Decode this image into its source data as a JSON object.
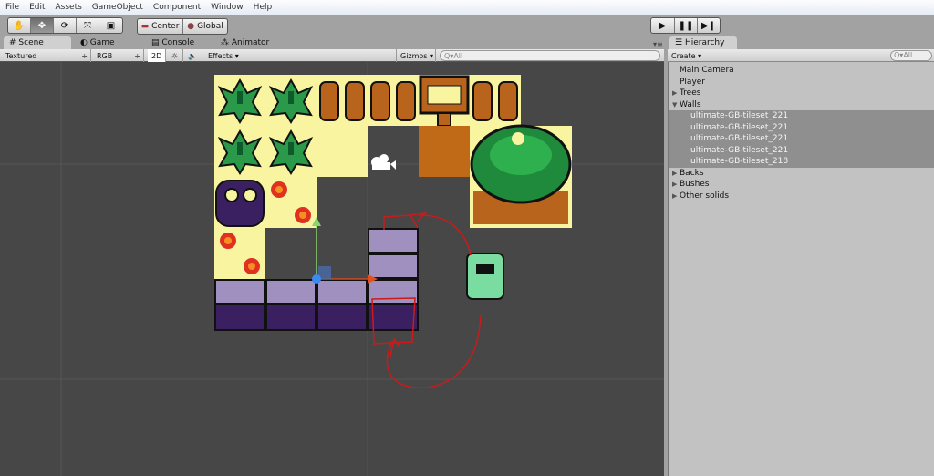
{
  "menu": [
    "File",
    "Edit",
    "Assets",
    "GameObject",
    "Component",
    "Window",
    "Help"
  ],
  "tools": {
    "pivot": "Center",
    "space": "Global"
  },
  "tabs": {
    "scene": "Scene",
    "game": "Game",
    "console": "Console",
    "animator": "Animator",
    "hierarchy": "Hierarchy"
  },
  "scenebar": {
    "render_mode": "Textured",
    "channel": "RGB",
    "mode2d": "2D",
    "effects": "Effects",
    "gizmos": "Gizmos",
    "search": "All"
  },
  "hierbar": {
    "create": "Create",
    "search": "All"
  },
  "hierarchy": [
    {
      "label": "Main Camera",
      "type": "item"
    },
    {
      "label": "Player",
      "type": "item"
    },
    {
      "label": "Trees",
      "type": "collapsed"
    },
    {
      "label": "Walls",
      "type": "expanded"
    },
    {
      "label": "ultimate-GB-tileset_221",
      "type": "selected"
    },
    {
      "label": "ultimate-GB-tileset_221",
      "type": "selected"
    },
    {
      "label": "ultimate-GB-tileset_221",
      "type": "selected"
    },
    {
      "label": "ultimate-GB-tileset_221",
      "type": "selected"
    },
    {
      "label": "ultimate-GB-tileset_218",
      "type": "selected"
    },
    {
      "label": "Backs",
      "type": "collapsed"
    },
    {
      "label": "Bushes",
      "type": "collapsed"
    },
    {
      "label": "Other solids",
      "type": "collapsed"
    }
  ],
  "colors": {
    "scene_bg": "#474747",
    "tile_bg": "#f8f4a0",
    "annotation": "#cc1a1a",
    "selection": "#8f8f8f"
  }
}
